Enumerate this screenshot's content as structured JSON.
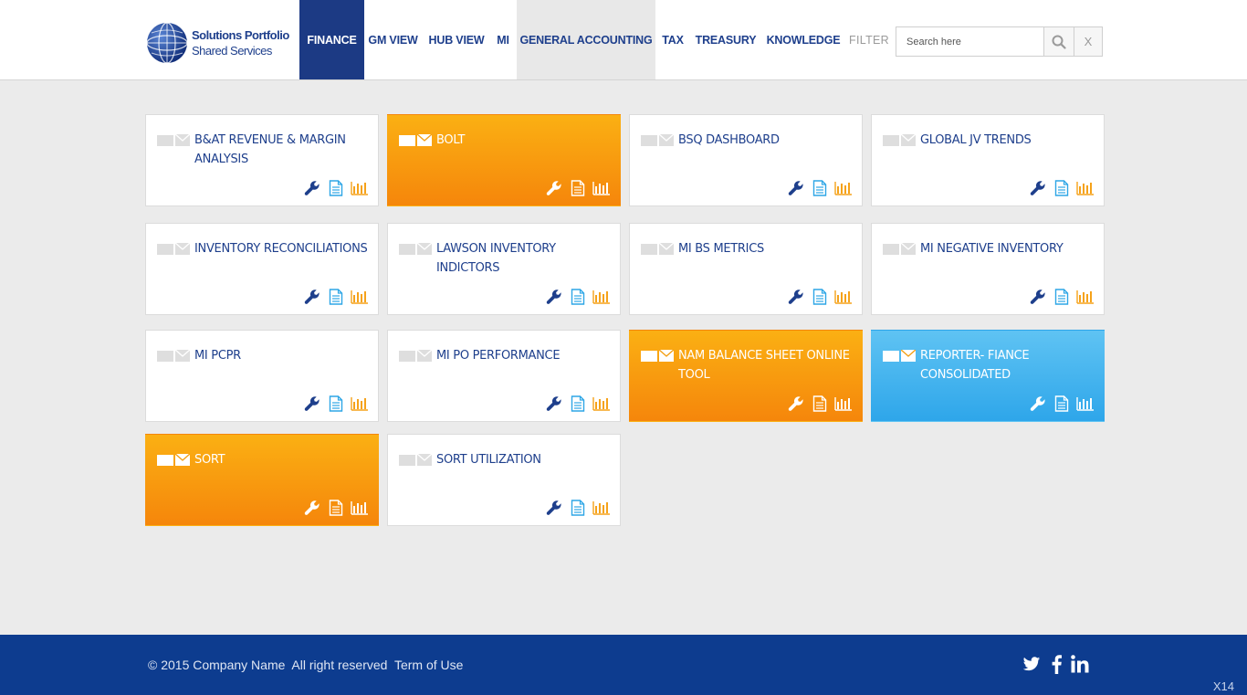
{
  "brand": {
    "line1": "Solutions Portfolio",
    "line2": "Shared Services"
  },
  "nav": {
    "finance": "FINANCE",
    "gm_view": "GM VIEW",
    "hub_view": "HUB VIEW",
    "mi": "MI",
    "general_accounting": "GENERAL ACCOUNTING",
    "tax": "TAX",
    "treasury": "TREASURY",
    "knowledge": "KNOWLEDGE",
    "filter": "FILTER"
  },
  "search": {
    "placeholder": "Search here",
    "clear_label": "X"
  },
  "tiles": [
    {
      "title": "B&AT REVENUE & MARGIN ANALYSIS",
      "style": "white"
    },
    {
      "title": "BOLT",
      "style": "orange"
    },
    {
      "title": "BSQ DASHBOARD",
      "style": "white"
    },
    {
      "title": "GLOBAL JV TRENDS",
      "style": "white"
    },
    {
      "title": "INVENTORY RECONCILIATIONS",
      "style": "white"
    },
    {
      "title": "LAWSON INVENTORY INDICTORS",
      "style": "white"
    },
    {
      "title": "MI BS METRICS",
      "style": "white"
    },
    {
      "title": "MI NEGATIVE INVENTORY",
      "style": "white"
    },
    {
      "title": "MI PCPR",
      "style": "white"
    },
    {
      "title": "MI PO PERFORMANCE",
      "style": "white"
    },
    {
      "title": "NAM BALANCE SHEET ONLINE TOOL",
      "style": "orange"
    },
    {
      "title": "REPORTER- FIANCE CONSOLIDATED",
      "style": "blue"
    },
    {
      "title": "SORT",
      "style": "orange"
    },
    {
      "title": "SORT UTILIZATION",
      "style": "white"
    }
  ],
  "footer": {
    "copyright": "© 2015 Company Name  All right reserved  Term of Use",
    "version": "X14"
  },
  "icons": {
    "wrench": "wrench-icon",
    "document": "document-icon",
    "chart": "bar-chart-icon",
    "mail": "mail-icon",
    "search": "search-icon",
    "twitter": "twitter-icon",
    "facebook": "facebook-icon",
    "linkedin": "linkedin-icon"
  },
  "colors": {
    "brand_blue": "#1e3f8c",
    "nav_active": "#1c3a84",
    "tile_orange_top": "#fbb013",
    "tile_orange_bottom": "#f5860b",
    "tile_blue_top": "#5fc3f3",
    "tile_blue_bottom": "#2ea6ea",
    "icon_cyan": "#2ea6e6",
    "icon_orange": "#f5a21a",
    "footer_bg": "#0d3c8f"
  }
}
